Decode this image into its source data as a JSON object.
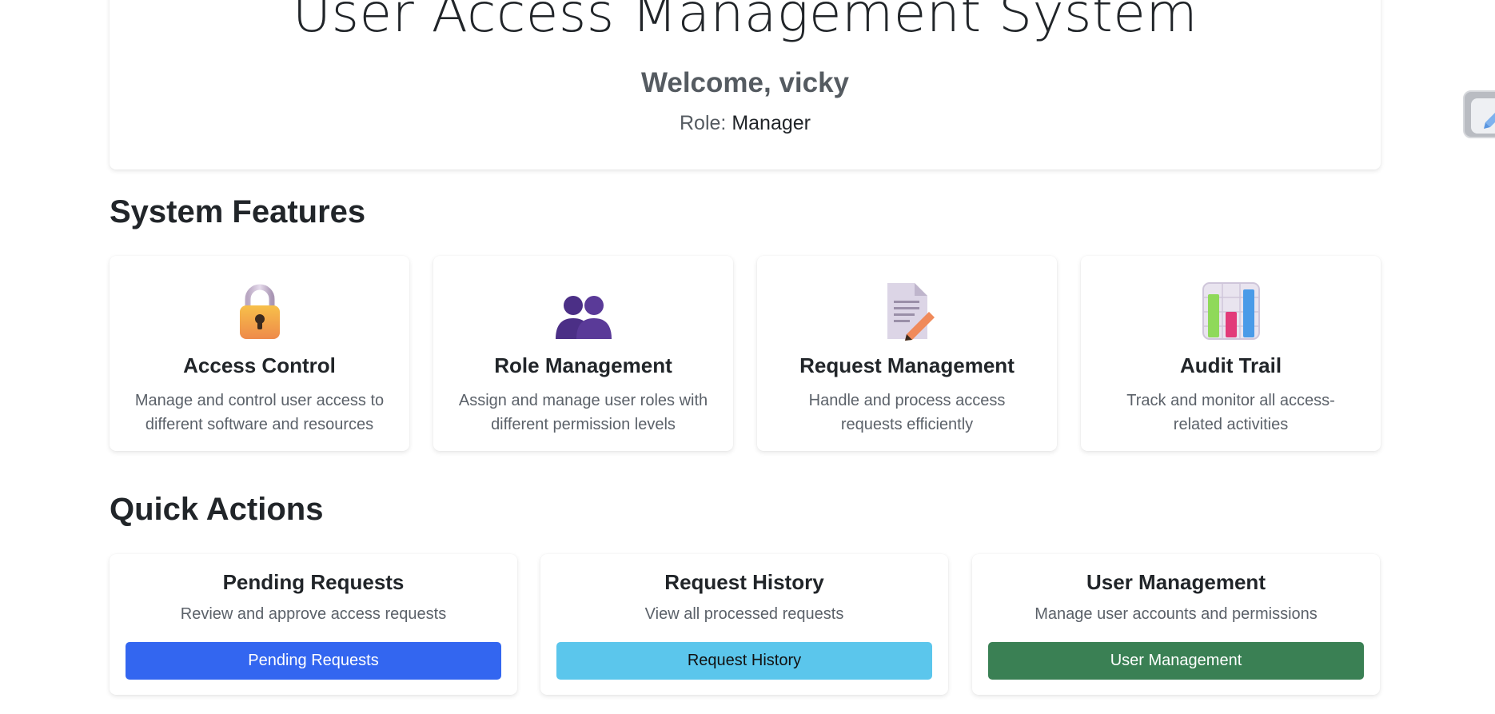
{
  "header": {
    "title": "User Access Management System",
    "welcome": "Welcome, vicky",
    "role_label": "Role:",
    "role_value": "Manager"
  },
  "features_section": {
    "title": "System Features",
    "cards": [
      {
        "icon": "lock-icon",
        "title": "Access Control",
        "description": "Manage and control user access to different software and resources"
      },
      {
        "icon": "people-icon",
        "title": "Role Management",
        "description": "Assign and manage user roles with different permission levels"
      },
      {
        "icon": "document-pencil-icon",
        "title": "Request Management",
        "description": "Handle and process access requests efficiently"
      },
      {
        "icon": "bar-chart-icon",
        "title": "Audit Trail",
        "description": "Track and monitor all access-related activities"
      }
    ]
  },
  "actions_section": {
    "title": "Quick Actions",
    "cards": [
      {
        "title": "Pending Requests",
        "description": "Review and approve access requests",
        "button_label": "Pending Requests",
        "button_color": "#3366f0",
        "button_text_color": "#ffffff"
      },
      {
        "title": "Request History",
        "description": "View all processed requests",
        "button_label": "Request History",
        "button_color": "#5bc6ec",
        "button_text_color": "#111111"
      },
      {
        "title": "User Management",
        "description": "Manage user accounts and permissions",
        "button_label": "User Management",
        "button_color": "#3a8054",
        "button_text_color": "#ffffff"
      }
    ]
  }
}
